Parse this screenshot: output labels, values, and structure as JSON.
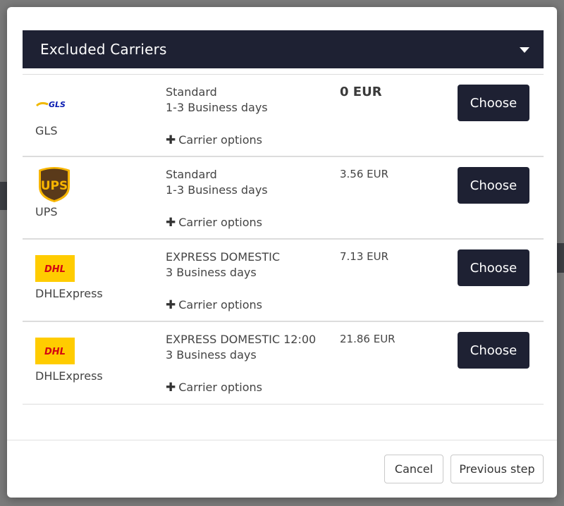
{
  "header": {
    "title": "Excluded Carriers"
  },
  "rows": [
    {
      "carrier": "GLS",
      "logo": "gls-logo",
      "service": "Standard",
      "days": "1-3 Business days",
      "options": "Carrier options",
      "price": "0 EUR",
      "button": "Choose"
    },
    {
      "carrier": "UPS",
      "logo": "ups-logo",
      "service": "Standard",
      "days": "1-3 Business days",
      "options": "Carrier options",
      "price": "3.56 EUR",
      "button": "Choose"
    },
    {
      "carrier": "DHLExpress",
      "logo": "dhl-logo",
      "service": "EXPRESS DOMESTIC",
      "days": "3 Business days",
      "options": "Carrier options",
      "price": "7.13 EUR",
      "button": "Choose"
    },
    {
      "carrier": "DHLExpress",
      "logo": "dhl-logo",
      "service": "EXPRESS DOMESTIC 12:00",
      "days": "3 Business days",
      "options": "Carrier options",
      "price": "21.86 EUR",
      "button": "Choose"
    }
  ],
  "logos": {
    "gls": "GLS",
    "ups": "UPS",
    "dhl": "DHL"
  },
  "footer": {
    "cancel": "Cancel",
    "previous": "Previous step"
  },
  "colors": {
    "primary": "#1e2133",
    "dhl_yellow": "#ffcc00",
    "dhl_red": "#d40511",
    "ups_brown": "#5a3a1a",
    "ups_gold": "#f7b500",
    "gls_blue": "#061ab1",
    "gls_yellow": "#f0b800"
  }
}
